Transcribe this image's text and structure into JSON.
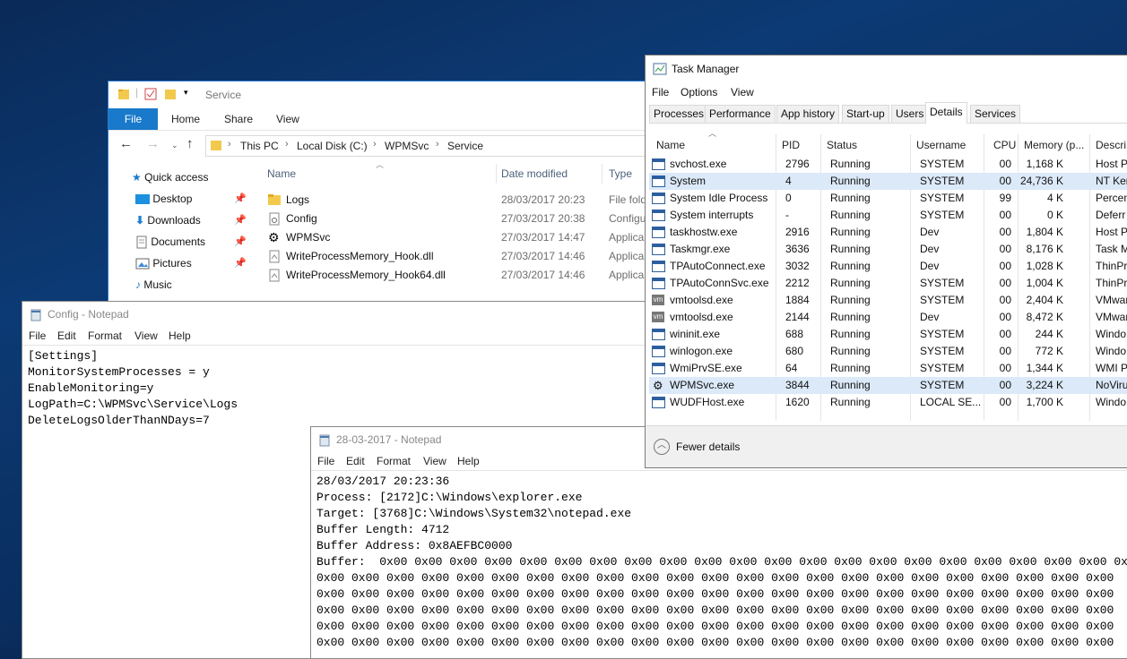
{
  "explorer": {
    "title": "Service",
    "ribbon": {
      "file": "File",
      "tabs": [
        "Home",
        "Share",
        "View"
      ]
    },
    "breadcrumb": [
      "This PC",
      "Local Disk (C:)",
      "WPMSvc",
      "Service"
    ],
    "nav": [
      {
        "label": "Quick access",
        "icon": "star-icon",
        "pinned": false
      },
      {
        "label": "Desktop",
        "icon": "desktop-icon",
        "pinned": true
      },
      {
        "label": "Downloads",
        "icon": "download-icon",
        "pinned": true
      },
      {
        "label": "Documents",
        "icon": "document-icon",
        "pinned": true
      },
      {
        "label": "Pictures",
        "icon": "pictures-icon",
        "pinned": true
      },
      {
        "label": "Music",
        "icon": "music-icon",
        "pinned": false
      }
    ],
    "columns": {
      "name": "Name",
      "date": "Date modified",
      "type": "Type"
    },
    "files": [
      {
        "name": "Logs",
        "date": "28/03/2017 20:23",
        "type": "File fold",
        "icon": "folder-icon"
      },
      {
        "name": "Config",
        "date": "27/03/2017 20:38",
        "type": "Configu",
        "icon": "config-file-icon"
      },
      {
        "name": "WPMSvc",
        "date": "27/03/2017 14:47",
        "type": "Applica",
        "icon": "gear-icon"
      },
      {
        "name": "WriteProcessMemory_Hook.dll",
        "date": "27/03/2017 14:46",
        "type": "Applica",
        "icon": "dll-icon"
      },
      {
        "name": "WriteProcessMemory_Hook64.dll",
        "date": "27/03/2017 14:46",
        "type": "Applica",
        "icon": "dll-icon"
      }
    ]
  },
  "notepad_config": {
    "title": "Config - Notepad",
    "menu": [
      "File",
      "Edit",
      "Format",
      "View",
      "Help"
    ],
    "content": "[Settings]\nMonitorSystemProcesses = y\nEnableMonitoring=y\nLogPath=C:\\WPMSvc\\Service\\Logs\nDeleteLogsOlderThanNDays=7"
  },
  "notepad_log": {
    "title": "28-03-2017 - Notepad",
    "menu": [
      "File",
      "Edit",
      "Format",
      "View",
      "Help"
    ],
    "content": "28/03/2017 20:23:36\nProcess: [2172]C:\\Windows\\explorer.exe\nTarget: [3768]C:\\Windows\\System32\\notepad.exe\nBuffer Length: 4712\nBuffer Address: 0x8AEFBC0000\nBuffer:  0x00 0x00 0x00 0x00 0x00 0x00 0x00 0x00 0x00 0x00 0x00 0x00 0x00 0x00 0x00 0x00 0x00 0x00 0x00 0x00 0x00 0x00\n0x00 0x00 0x00 0x00 0x00 0x00 0x00 0x00 0x00 0x00 0x00 0x00 0x00 0x00 0x00 0x00 0x00 0x00 0x00 0x00 0x00 0x00 0x00\n0x00 0x00 0x00 0x00 0x00 0x00 0x00 0x00 0x00 0x00 0x00 0x00 0x00 0x00 0x00 0x00 0x00 0x00 0x00 0x00 0x00 0x00 0x00\n0x00 0x00 0x00 0x00 0x00 0x00 0x00 0x00 0x00 0x00 0x00 0x00 0x00 0x00 0x00 0x00 0x00 0x00 0x00 0x00 0x00 0x00 0x00\n0x00 0x00 0x00 0x00 0x00 0x00 0x00 0x00 0x00 0x00 0x00 0x00 0x00 0x00 0x00 0x00 0x00 0x00 0x00 0x00 0x00 0x00 0x00\n0x00 0x00 0x00 0x00 0x00 0x00 0x00 0x00 0x00 0x00 0x00 0x00 0x00 0x00 0x00 0x00 0x00 0x00 0x00 0x00 0x00 0x00 0x00"
  },
  "taskmgr": {
    "title": "Task Manager",
    "menu": [
      "File",
      "Options",
      "View"
    ],
    "tabs": [
      "Processes",
      "Performance",
      "App history",
      "Start-up",
      "Users",
      "Details",
      "Services"
    ],
    "active_tab": "Details",
    "columns": [
      "Name",
      "PID",
      "Status",
      "Username",
      "CPU",
      "Memory (p...",
      "Descri"
    ],
    "rows": [
      {
        "name": "svchost.exe",
        "pid": "2796",
        "status": "Running",
        "user": "SYSTEM",
        "cpu": "00",
        "mem": "1,168 K",
        "desc": "Host P",
        "icon": "window-icon",
        "selected": false
      },
      {
        "name": "System",
        "pid": "4",
        "status": "Running",
        "user": "SYSTEM",
        "cpu": "00",
        "mem": "24,736 K",
        "desc": "NT Ker",
        "icon": "window-icon",
        "selected": true
      },
      {
        "name": "System Idle Process",
        "pid": "0",
        "status": "Running",
        "user": "SYSTEM",
        "cpu": "99",
        "mem": "4 K",
        "desc": "Percen",
        "icon": "window-icon",
        "selected": false
      },
      {
        "name": "System interrupts",
        "pid": "-",
        "status": "Running",
        "user": "SYSTEM",
        "cpu": "00",
        "mem": "0 K",
        "desc": "Deferr",
        "icon": "window-icon",
        "selected": false
      },
      {
        "name": "taskhostw.exe",
        "pid": "2916",
        "status": "Running",
        "user": "Dev",
        "cpu": "00",
        "mem": "1,804 K",
        "desc": "Host P",
        "icon": "window-icon",
        "selected": false
      },
      {
        "name": "Taskmgr.exe",
        "pid": "3636",
        "status": "Running",
        "user": "Dev",
        "cpu": "00",
        "mem": "8,176 K",
        "desc": "Task M",
        "icon": "taskmgr-icon",
        "selected": false
      },
      {
        "name": "TPAutoConnect.exe",
        "pid": "3032",
        "status": "Running",
        "user": "Dev",
        "cpu": "00",
        "mem": "1,028 K",
        "desc": "ThinPr",
        "icon": "thinprint-icon",
        "selected": false
      },
      {
        "name": "TPAutoConnSvc.exe",
        "pid": "2212",
        "status": "Running",
        "user": "SYSTEM",
        "cpu": "00",
        "mem": "1,004 K",
        "desc": "ThinPr",
        "icon": "thinprint-icon",
        "selected": false
      },
      {
        "name": "vmtoolsd.exe",
        "pid": "1884",
        "status": "Running",
        "user": "SYSTEM",
        "cpu": "00",
        "mem": "2,404 K",
        "desc": "VMwar",
        "icon": "vm-icon",
        "selected": false
      },
      {
        "name": "vmtoolsd.exe",
        "pid": "2144",
        "status": "Running",
        "user": "Dev",
        "cpu": "00",
        "mem": "8,472 K",
        "desc": "VMwar",
        "icon": "vm-icon",
        "selected": false
      },
      {
        "name": "wininit.exe",
        "pid": "688",
        "status": "Running",
        "user": "SYSTEM",
        "cpu": "00",
        "mem": "244 K",
        "desc": "Windo",
        "icon": "window-icon",
        "selected": false
      },
      {
        "name": "winlogon.exe",
        "pid": "680",
        "status": "Running",
        "user": "SYSTEM",
        "cpu": "00",
        "mem": "772 K",
        "desc": "Windo",
        "icon": "window-icon",
        "selected": false
      },
      {
        "name": "WmiPrvSE.exe",
        "pid": "64",
        "status": "Running",
        "user": "SYSTEM",
        "cpu": "00",
        "mem": "1,344 K",
        "desc": "WMI P",
        "icon": "wmi-icon",
        "selected": false
      },
      {
        "name": "WPMSvc.exe",
        "pid": "3844",
        "status": "Running",
        "user": "SYSTEM",
        "cpu": "00",
        "mem": "3,224 K",
        "desc": "NoViru",
        "icon": "gear-icon",
        "selected": true
      },
      {
        "name": "WUDFHost.exe",
        "pid": "1620",
        "status": "Running",
        "user": "LOCAL SE...",
        "cpu": "00",
        "mem": "1,700 K",
        "desc": "Windo",
        "icon": "window-icon",
        "selected": false
      }
    ],
    "fewer_details": "Fewer details"
  },
  "colors": {
    "ribbon_file": "#1979ca",
    "selection": "#dbe9f8",
    "desktop": "#0c3a74"
  }
}
